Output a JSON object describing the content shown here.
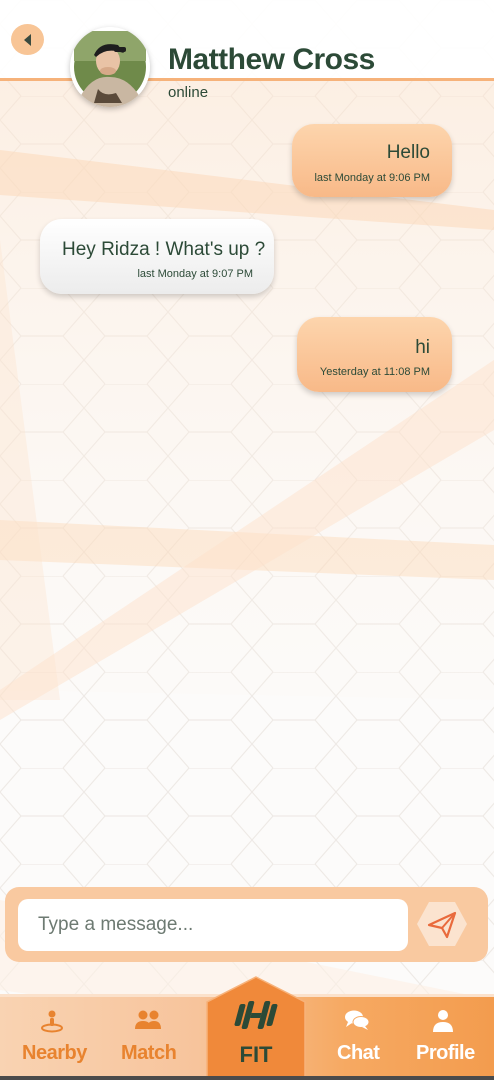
{
  "header": {
    "contact_name": "Matthew Cross",
    "status": "online"
  },
  "messages": [
    {
      "direction": "out",
      "text": "Hello",
      "time": "last Monday at 9:06 PM"
    },
    {
      "direction": "in",
      "text": "Hey Ridza ! What's up ?",
      "time": "last Monday at 9:07 PM"
    },
    {
      "direction": "out",
      "text": "hi",
      "time": "Yesterday at 11:08 PM"
    }
  ],
  "composer": {
    "placeholder": "Type a message..."
  },
  "nav": {
    "nearby": "Nearby",
    "match": "Match",
    "fit": "FIT",
    "chat": "Chat",
    "profile": "Profile"
  },
  "colors": {
    "accent": "#f39c4e",
    "text_dark": "#2c4a37",
    "bubble_out": "#f8b988",
    "bubble_in": "#ffffff"
  }
}
